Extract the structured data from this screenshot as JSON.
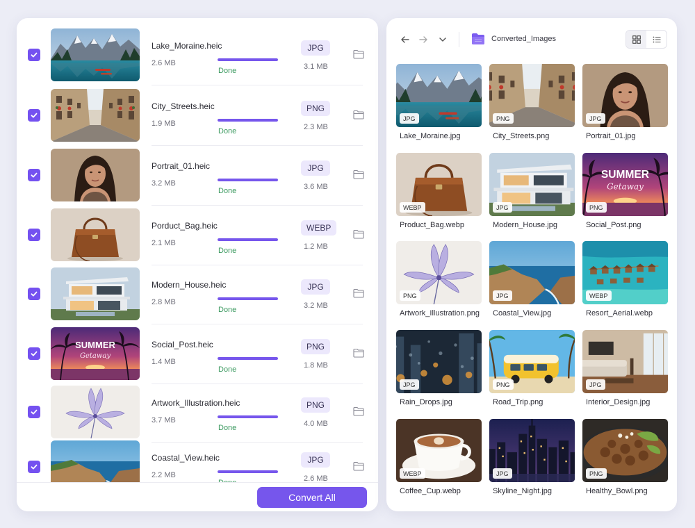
{
  "left_panel": {
    "files": [
      {
        "name": "Lake_Moraine.heic",
        "size": "2.6 MB",
        "status": "Done",
        "progress": 1.0,
        "format": "JPG",
        "output_size": "3.1 MB",
        "checked": true
      },
      {
        "name": "City_Streets.heic",
        "size": "1.9 MB",
        "status": "Done",
        "progress": 1.0,
        "format": "PNG",
        "output_size": "2.3 MB",
        "checked": true
      },
      {
        "name": "Portrait_01.heic",
        "size": "3.2 MB",
        "status": "Done",
        "progress": 1.0,
        "format": "JPG",
        "output_size": "3.6 MB",
        "checked": true
      },
      {
        "name": "Porduct_Bag.heic",
        "size": "2.1 MB",
        "status": "Done",
        "progress": 1.0,
        "format": "WEBP",
        "output_size": "1.2 MB",
        "checked": true
      },
      {
        "name": "Modern_House.heic",
        "size": "2.8 MB",
        "status": "Done",
        "progress": 1.0,
        "format": "JPG",
        "output_size": "3.2 MB",
        "checked": true
      },
      {
        "name": "Social_Post.heic",
        "size": "1.4 MB",
        "status": "Done",
        "progress": 1.0,
        "format": "PNG",
        "output_size": "1.8 MB",
        "checked": true
      },
      {
        "name": "Artwork_Illustration.heic",
        "size": "3.7 MB",
        "status": "Done",
        "progress": 1.0,
        "format": "PNG",
        "output_size": "4.0 MB",
        "checked": true
      },
      {
        "name": "Coastal_View.heic",
        "size": "2.2 MB",
        "status": "Done",
        "progress": 1.0,
        "format": "JPG",
        "output_size": "2.6 MB",
        "checked": true
      }
    ],
    "convert_button": "Convert All",
    "accent_color": "#7656ec"
  },
  "right_panel": {
    "toolbar": {
      "back_icon": "arrow-left-icon",
      "forward_icon": "arrow-right-icon",
      "dropdown_icon": "chevron-down-icon",
      "folder_name": "Converted_Images",
      "view_modes": [
        "grid-view-icon",
        "list-view-icon"
      ],
      "active_view": "grid"
    },
    "images": [
      {
        "name": "Lake_Moraine.jpg",
        "badge": "JPG",
        "thumb": "lake"
      },
      {
        "name": "City_Streets.png",
        "badge": "PNG",
        "thumb": "street"
      },
      {
        "name": "Portrait_01.jpg",
        "badge": "JPG",
        "thumb": "portrait"
      },
      {
        "name": "Product_Bag.webp",
        "badge": "WEBP",
        "thumb": "bag"
      },
      {
        "name": "Modern_House.jpg",
        "badge": "JPG",
        "thumb": "house"
      },
      {
        "name": "Social_Post.png",
        "badge": "PNG",
        "thumb": "summer"
      },
      {
        "name": "Artwork_Illustration.png",
        "badge": "PNG",
        "thumb": "flower"
      },
      {
        "name": "Coastal_View.jpg",
        "badge": "JPG",
        "thumb": "coast"
      },
      {
        "name": "Resort_Aerial.webp",
        "badge": "WEBP",
        "thumb": "resort"
      },
      {
        "name": "Rain_Drops.jpg",
        "badge": "JPG",
        "thumb": "rain"
      },
      {
        "name": "Road_Trip.png",
        "badge": "PNG",
        "thumb": "van"
      },
      {
        "name": "Interior_Design.jpg",
        "badge": "JPG",
        "thumb": "interior"
      },
      {
        "name": "Coffee_Cup.webp",
        "badge": "WEBP",
        "thumb": "coffee"
      },
      {
        "name": "Skyline_Night.jpg",
        "badge": "JPG",
        "thumb": "skyline"
      },
      {
        "name": "Healthy_Bowl.png",
        "badge": "PNG",
        "thumb": "bowl"
      }
    ]
  },
  "thumbnail_text": {
    "summer_title": "SUMMER",
    "summer_subtitle": "Getaway"
  }
}
